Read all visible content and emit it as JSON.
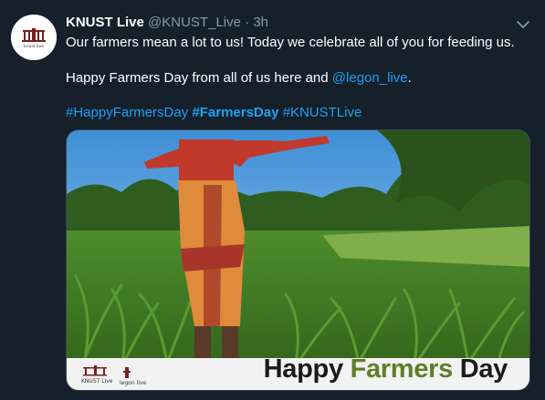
{
  "tweet": {
    "author_name": "KNUST Live",
    "author_handle": "@KNUST_Live",
    "separator": "·",
    "time": "3h",
    "line1": "Our farmers mean a lot to us! Today we celebrate all of you for feeding us.",
    "line2_prefix": "Happy Farmers Day from all of us here and ",
    "line2_mention": "@legon_live",
    "line2_suffix": ".",
    "hashtags": [
      "#HappyFarmersDay",
      "#FarmersDay",
      "#KNUSTLive"
    ],
    "avatar_text": "knust live"
  },
  "media": {
    "banner_word1": "Happy",
    "banner_word2": "Farmers",
    "banner_word3": "Day",
    "logo1_text": "KNUST Live",
    "logo2_text": "legon live"
  },
  "colors": {
    "background": "#15202b",
    "link": "#1da1f2",
    "muted": "#8899a6",
    "banner_green": "#5c7f2a"
  }
}
